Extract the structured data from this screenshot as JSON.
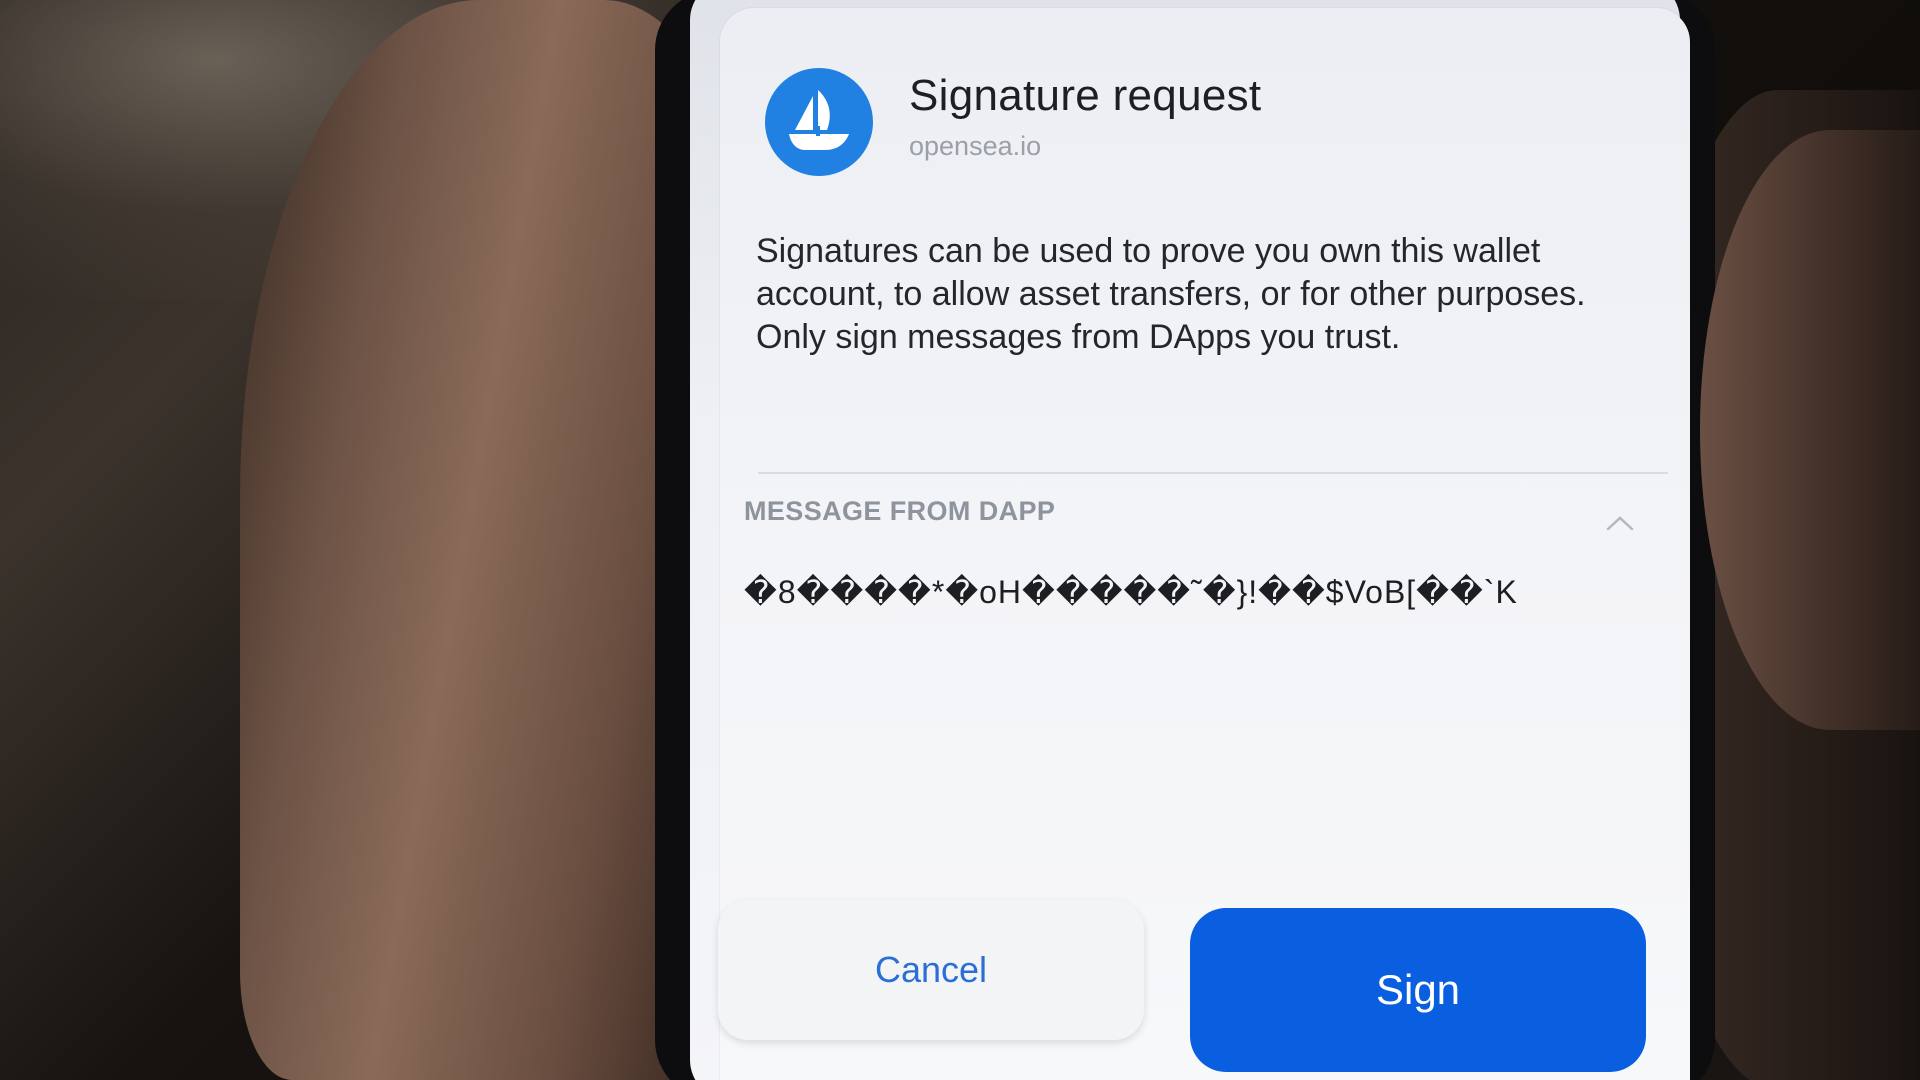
{
  "dialog": {
    "title": "Signature request",
    "origin": "opensea.io",
    "logo_icon": "opensea-ship-icon",
    "description": "Signatures can be used to prove you own this wallet account, to allow asset transfers, or for other purposes. Only sign messages from DApps you trust.",
    "section_label": "MESSAGE FROM DAPP",
    "collapse_icon": "chevron-up-icon",
    "message": "�8����*�oH�����˜�}!��$VoB[��`K"
  },
  "actions": {
    "cancel_label": "Cancel",
    "sign_label": "Sign"
  },
  "colors": {
    "accent": "#0a5fe0",
    "logo_blue": "#2081e2",
    "cancel_text": "#2b6fd6"
  }
}
